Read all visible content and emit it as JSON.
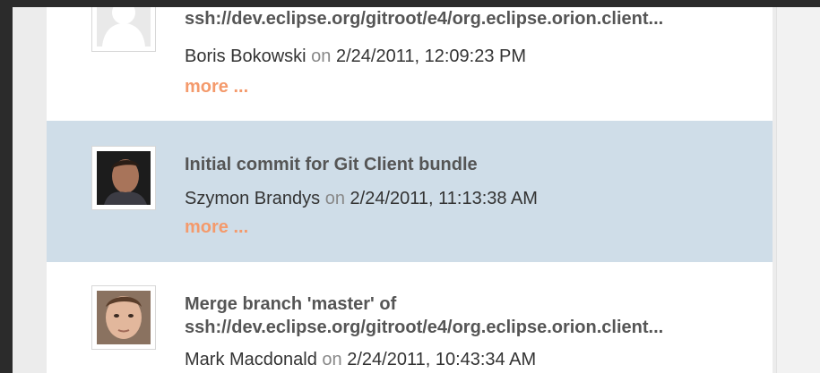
{
  "commits": [
    {
      "message_lines": [
        "ssh://dev.eclipse.org/gitroot/e4/org.eclipse.orion.client..."
      ],
      "author": "Boris Bokowski",
      "on": "on",
      "date": "2/24/2011, 12:09:23 PM",
      "more": "more ..."
    },
    {
      "message_lines": [
        "Initial commit for Git Client bundle"
      ],
      "author": "Szymon Brandys",
      "on": "on",
      "date": "2/24/2011, 11:13:38 AM",
      "more": "more ..."
    },
    {
      "message_lines": [
        "Merge branch 'master' of",
        "ssh://dev.eclipse.org/gitroot/e4/org.eclipse.orion.client..."
      ],
      "author": "Mark Macdonald",
      "on": "on",
      "date": "2/24/2011, 10:43:34 AM"
    }
  ],
  "colors": {
    "selected_row": "#cfdde8",
    "more_link": "#f49a6c",
    "message_text": "#555555"
  }
}
